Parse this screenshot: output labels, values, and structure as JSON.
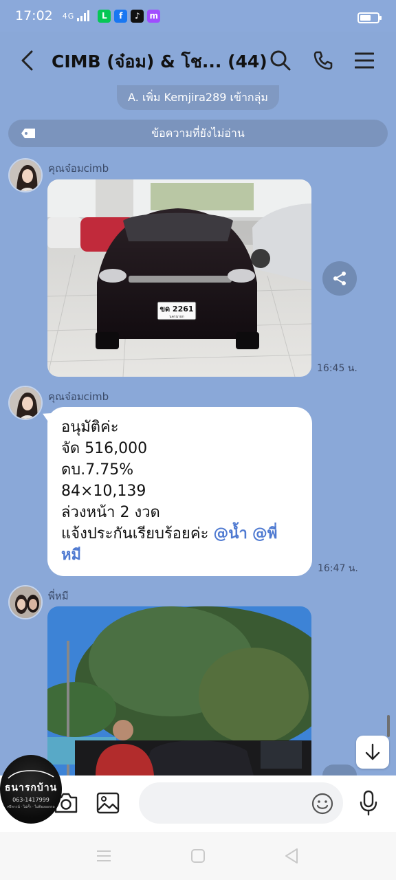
{
  "status": {
    "time": "17:02",
    "network": "4G",
    "apps": [
      {
        "icon": "line-icon",
        "color": "#06c755",
        "glyph": "L"
      },
      {
        "icon": "facebook-icon",
        "color": "#1877f2",
        "glyph": "f"
      },
      {
        "icon": "tiktok-icon",
        "color": "#111111",
        "glyph": "♪"
      },
      {
        "icon": "messenger-icon",
        "color": "#a04dff",
        "glyph": "m"
      }
    ]
  },
  "header": {
    "title": "CIMB (จ๋อม) & โช... (44)"
  },
  "system_message": "A. เพิ่ม Kemjira289 เข้ากลุ่ม",
  "unread_label": "ข้อความที่ยังไม่อ่าน",
  "messages": [
    {
      "sender": "คุณจ๋อมcimb",
      "type": "photo",
      "plate": "ขด 2261",
      "plate_sub": "นครนายก",
      "time": "16:45 น."
    },
    {
      "sender": "คุณจ๋อมcimb",
      "type": "text",
      "lines": [
        "อนุมัติค่ะ",
        "จัด 516,000",
        "ดบ.7.75%",
        "84×10,139",
        "ล่วงหน้า 2 งวด"
      ],
      "last_line_text": "แจ้งประกันเรียบร้อยค่ะ ",
      "mention1": "@น้ำ",
      "mention2": "@พี่",
      "mention2_cont": "หมี",
      "time": "16:47 น."
    },
    {
      "sender": "พี่หมี",
      "type": "photo"
    }
  ],
  "input": {
    "placeholder": ""
  },
  "logo": {
    "line1": "ธนารกบ้าน",
    "line2": "063-1417999",
    "line3": "ฟรีดาวน์ · ไม่ค้ำ · ไม่ต้องออกรถ"
  },
  "colors": {
    "background": "#8aa8d8",
    "mention": "#4f7ad1"
  }
}
